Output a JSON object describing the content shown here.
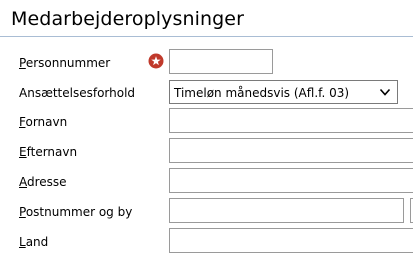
{
  "header": {
    "title": "Medarbejderoplysninger"
  },
  "form": {
    "personnummer": {
      "label_ul": "P",
      "label_rest": "ersonnummer",
      "value": ""
    },
    "ansaettelse": {
      "label": "Ansættelsesforhold",
      "selected": "Timeløn månedsvis (Afl.f. 03)"
    },
    "fornavn": {
      "label_ul": "F",
      "label_rest": "ornavn",
      "value": ""
    },
    "efternavn": {
      "label_ul": "E",
      "label_rest": "fternavn",
      "value": ""
    },
    "adresse": {
      "label_ul": "A",
      "label_rest": "dresse",
      "value": ""
    },
    "postnummer": {
      "label_ul": "P",
      "label_rest": "ostnummer og by",
      "postnr_value": "",
      "by_value": ""
    },
    "land": {
      "label_ul": "L",
      "label_rest": "and",
      "value": ""
    }
  },
  "colors": {
    "required": "#c0392b",
    "border": "#9a9a9a",
    "rule": "#a9bdd4"
  },
  "icons": {
    "required": "required-star-icon",
    "dropdown": "chevron-down-icon"
  }
}
